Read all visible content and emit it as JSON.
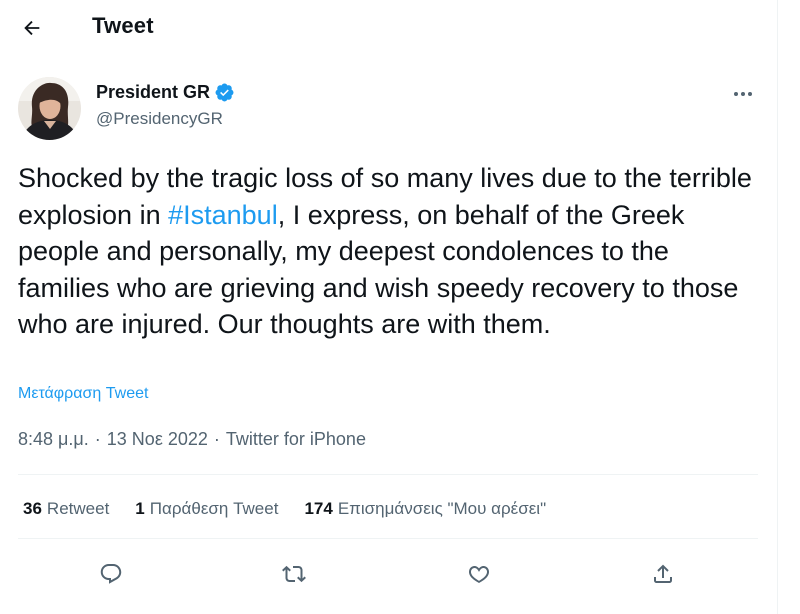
{
  "header": {
    "title": "Tweet",
    "back_icon": "arrow-left-icon"
  },
  "author": {
    "display_name": "President GR",
    "handle": "@PresidencyGR",
    "verified": true,
    "verified_color": "#1d9bf0"
  },
  "tweet": {
    "text_before": "Shocked by the tragic loss of so many lives due to the terrible explosion in ",
    "hashtag": "#Istanbul",
    "text_after": ", I express, on behalf of the Greek people and personally, my deepest condolences to the families who are grieving and wish speedy recovery to those who are injured. Our thoughts are with them.",
    "translate_label": "Μετάφραση Tweet"
  },
  "meta": {
    "time": "8:48 μ.μ.",
    "separator": "·",
    "date": "13 Νοε 2022",
    "source": "Twitter for iPhone"
  },
  "stats": {
    "retweets": {
      "count": "36",
      "label": "Retweet"
    },
    "quotes": {
      "count": "1",
      "label": "Παράθεση Tweet"
    },
    "likes": {
      "count": "174",
      "label": "Επισημάνσεις \"Μου αρέσει\""
    }
  },
  "actions": [
    "reply-icon",
    "retweet-icon",
    "like-icon",
    "share-icon"
  ],
  "colors": {
    "accent": "#1d9bf0",
    "text": "#0f1419",
    "secondary": "#536471",
    "border": "#eff3f4"
  }
}
